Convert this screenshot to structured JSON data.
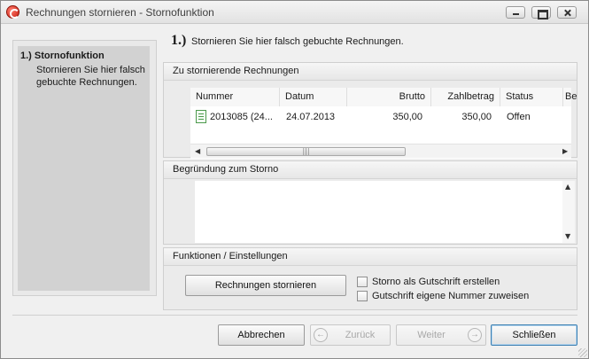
{
  "window": {
    "title": "Rechnungen stornieren - Stornofunktion"
  },
  "sidebar": {
    "step_title": "1.) Stornofunktion",
    "step_description": "Stornieren Sie hier falsch gebuchte Rechnungen."
  },
  "header": {
    "number": "1.)",
    "text": "Stornieren Sie hier falsch gebuchte Rechnungen."
  },
  "invoices_group": {
    "title": "Zu stornierende Rechnungen",
    "columns": [
      "Nummer",
      "Datum",
      "Brutto",
      "Zahlbetrag",
      "Status",
      "Be"
    ],
    "rows": [
      {
        "nummer": "2013085 (24...",
        "datum": "24.07.2013",
        "brutto": "350,00",
        "zahlbetrag": "350,00",
        "status": "Offen"
      }
    ],
    "scroll_thumb_glyph": "|||"
  },
  "reason_group": {
    "title": "Begründung zum Storno",
    "value": ""
  },
  "functions_group": {
    "title": "Funktionen / Einstellungen",
    "cancel_invoices_button": "Rechnungen stornieren",
    "checkbox_credit_note": "Storno als Gutschrift erstellen",
    "checkbox_own_number": "Gutschrift eigene Nummer zuweisen"
  },
  "footer": {
    "abbrechen": "Abbrechen",
    "zurueck": "Zurück",
    "weiter": "Weiter",
    "schliessen": "Schließen"
  }
}
